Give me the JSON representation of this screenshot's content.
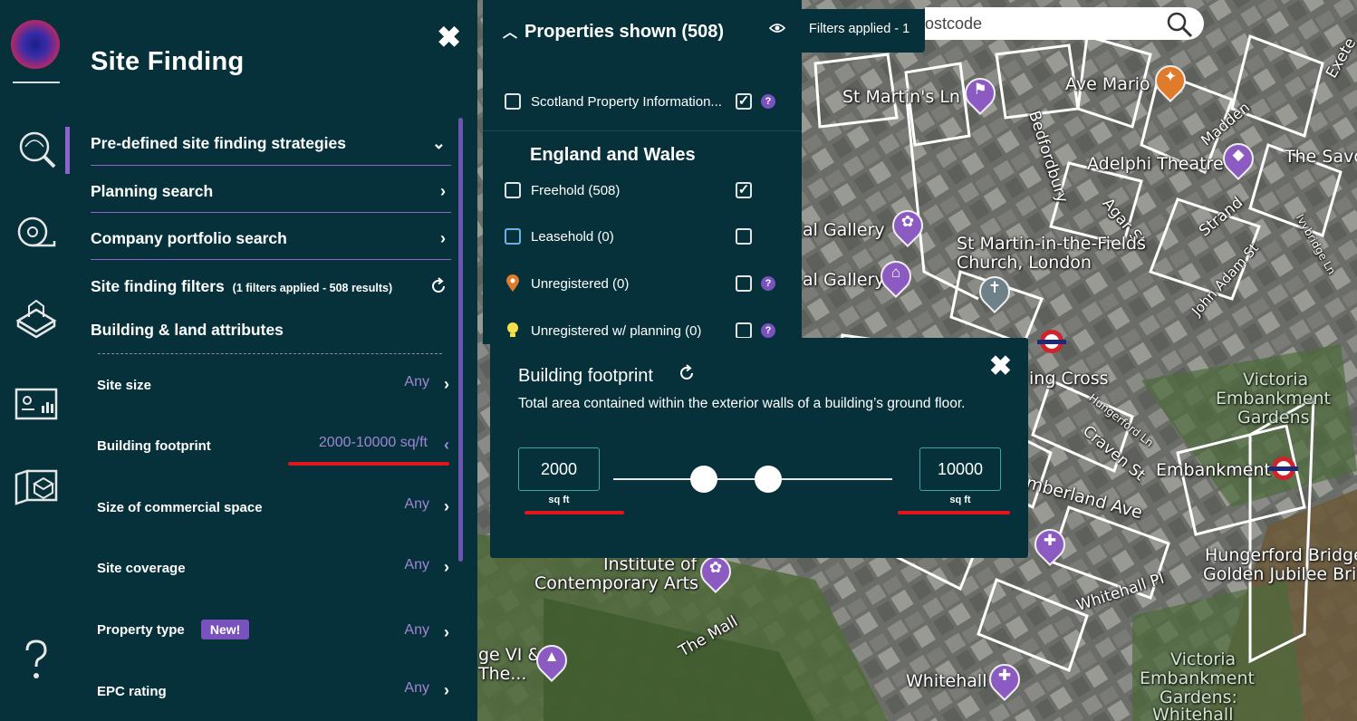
{
  "map": {
    "labels": [
      {
        "text": "St Martin's Ln"
      },
      {
        "text": "Ave Mario"
      },
      {
        "text": "Bedfordbury"
      },
      {
        "text": "Adelphi Theatre"
      },
      {
        "text": "The Savoy"
      },
      {
        "text": "Agar St"
      },
      {
        "text": "Strand"
      },
      {
        "text": "John Adam St"
      },
      {
        "text": "Ivybridge Ln"
      },
      {
        "text": "Madden"
      },
      {
        "text": "Exete"
      },
      {
        "text": "al Gallery"
      },
      {
        "text": "al Gallery"
      },
      {
        "text": "St Martin-in-the-Fields"
      },
      {
        "text": "Church, London"
      },
      {
        "text": "ing Cross"
      },
      {
        "text": "Hungerford Ln"
      },
      {
        "text": "Craven St"
      },
      {
        "text": "Victoria"
      },
      {
        "text": "Embankment"
      },
      {
        "text": "Gardens"
      },
      {
        "text": "mberland Ave"
      },
      {
        "text": "Embankment"
      },
      {
        "text": "Hungerford Bridge"
      },
      {
        "text": "Golden Jubilee Bri"
      },
      {
        "text": "Whitehall Pl"
      },
      {
        "text": "Institute of"
      },
      {
        "text": "Contemporary Arts"
      },
      {
        "text": "The Mall"
      },
      {
        "text": "ge VI &"
      },
      {
        "text": "The..."
      },
      {
        "text": "Whitehall"
      },
      {
        "text": "Victoria"
      },
      {
        "text": "Embankment"
      },
      {
        "text": "Gardens:"
      },
      {
        "text": "Whitehall"
      }
    ]
  },
  "rail": {
    "icons": [
      "site-finding-icon",
      "measure-tape-icon",
      "building-3d-icon",
      "dashboard-icon",
      "map-box-icon",
      "help-icon"
    ]
  },
  "panel": {
    "title": "Site Finding",
    "close": "✖",
    "sections": {
      "predefined": "Pre-defined site finding strategies",
      "planning": "Planning search",
      "company": "Company portfolio search",
      "filters": "Site finding filters",
      "filters_note": "(1 filters applied - 508 results)",
      "attributes": "Building & land attributes"
    },
    "attributes": [
      {
        "label": "Site size",
        "value": "Any"
      },
      {
        "label": "Building footprint",
        "value": "2000-10000 sq/ft"
      },
      {
        "label": "Size of commercial space",
        "value": "Any"
      },
      {
        "label": "Site coverage",
        "value": "Any"
      },
      {
        "label": "Property type",
        "value": "Any",
        "badge": "New!"
      },
      {
        "label": "EPC rating",
        "value": "Any"
      }
    ]
  },
  "properties": {
    "heading": "Properties shown (508)",
    "scotland": "Scotland Property Information...",
    "region": "England and Wales",
    "rows": [
      {
        "label": "Freehold (508)",
        "checked": true
      },
      {
        "label": "Leasehold (0)",
        "checked": false
      },
      {
        "label": "Unregistered (0)",
        "checked": false
      },
      {
        "label": "Unregistered w/ planning (0)",
        "checked": false
      }
    ]
  },
  "topbar": {
    "filters_applied": "Filters applied - 1",
    "search_value": "ostcode"
  },
  "footprint_popup": {
    "title": "Building footprint",
    "description": "Total area contained within the exterior walls of a building’s ground floor.",
    "min": "2000",
    "max": "10000",
    "unit": "sq ft",
    "range": {
      "min": 2000,
      "max": 10000
    }
  },
  "colors": {
    "panel_bg": "#06313a",
    "accent": "#8b63c9",
    "highlight_red": "#e3161c"
  }
}
